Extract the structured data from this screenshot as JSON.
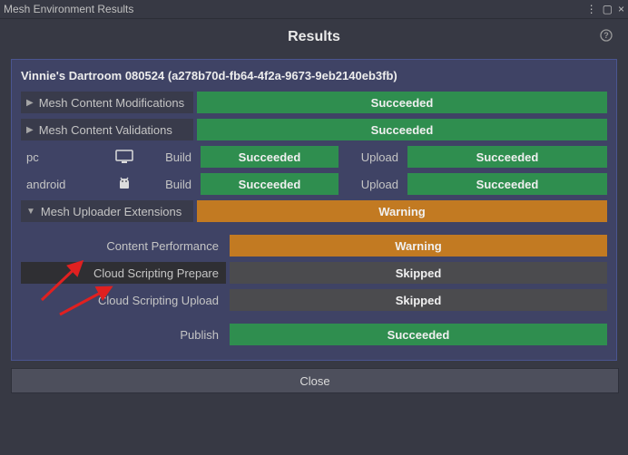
{
  "window": {
    "title": "Mesh Environment Results",
    "controls": {
      "menu": "⋮",
      "maximize": "▢",
      "close": "×"
    }
  },
  "header": {
    "title": "Results",
    "help": "?"
  },
  "panel": {
    "title": "Vinnie's Dartroom 080524 (a278b70d-fb64-4f2a-9673-9eb2140eb3fb)",
    "modifications": {
      "label": "Mesh Content Modifications",
      "status": "Succeeded"
    },
    "validations": {
      "label": "Mesh Content Validations",
      "status": "Succeeded"
    },
    "platforms": [
      {
        "name": "pc",
        "icon": "monitor-icon",
        "build_label": "Build",
        "build_status": "Succeeded",
        "upload_label": "Upload",
        "upload_status": "Succeeded"
      },
      {
        "name": "android",
        "icon": "android-icon",
        "build_label": "Build",
        "build_status": "Succeeded",
        "upload_label": "Upload",
        "upload_status": "Succeeded"
      }
    ],
    "uploader": {
      "label": "Mesh Uploader Extensions",
      "status": "Warning",
      "items": [
        {
          "label": "Content Performance",
          "status": "Warning"
        },
        {
          "label": "Cloud Scripting Prepare",
          "status": "Skipped"
        },
        {
          "label": "Cloud Scripting Upload",
          "status": "Skipped"
        }
      ]
    },
    "publish": {
      "label": "Publish",
      "status": "Succeeded"
    }
  },
  "footer": {
    "close": "Close"
  },
  "colors": {
    "success": "#2f8e4f",
    "warning": "#c27a22",
    "skipped": "#4b4b4e",
    "panel_border": "#4a5590",
    "arrow": "#e02020"
  }
}
